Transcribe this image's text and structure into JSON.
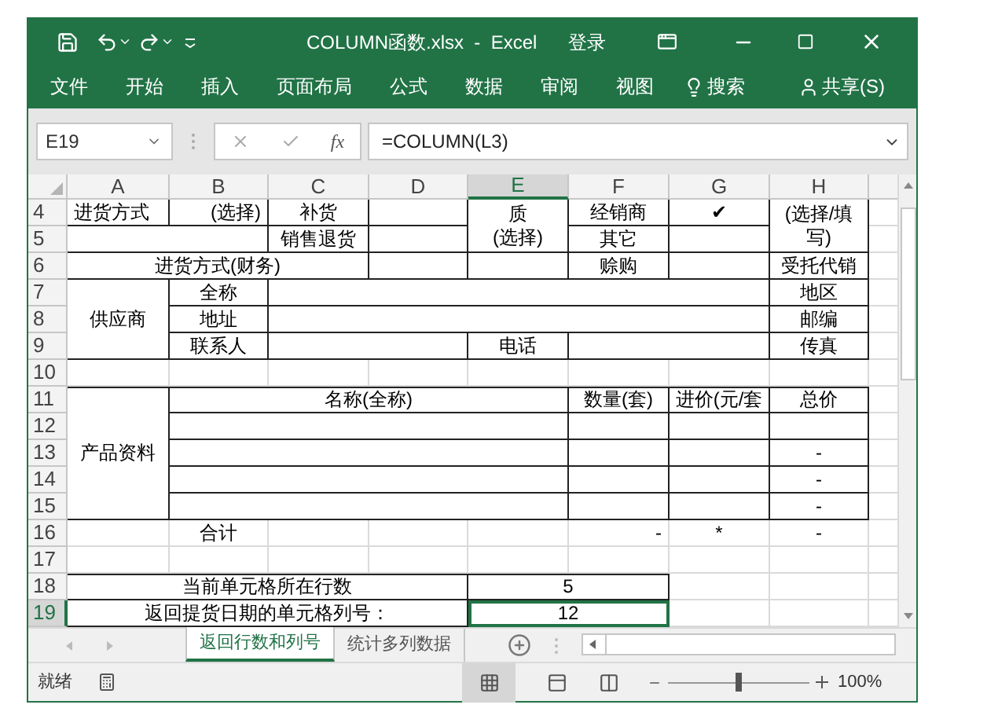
{
  "window": {
    "title": "COLUMN函数.xlsx  -  Excel",
    "sign_in": "登录"
  },
  "ribbon_tabs": [
    "文件",
    "开始",
    "插入",
    "页面布局",
    "公式",
    "数据",
    "审阅",
    "视图"
  ],
  "search": "搜索",
  "share": "共享(S)",
  "formula_bar": {
    "name_box": "E19",
    "fx": "fx",
    "formula": "=COLUMN(L3)"
  },
  "columns": [
    {
      "label": "A",
      "selected": false
    },
    {
      "label": "B",
      "selected": false
    },
    {
      "label": "C",
      "selected": false
    },
    {
      "label": "D",
      "selected": false
    },
    {
      "label": "E",
      "selected": true
    },
    {
      "label": "F",
      "selected": false
    },
    {
      "label": "G",
      "selected": false
    },
    {
      "label": "H",
      "selected": false
    }
  ],
  "rows": [
    {
      "number": "4",
      "selected": false,
      "cells": [
        "进货方式",
        "(选择)",
        "补货",
        "质\n(选择)",
        "经销商",
        "✔",
        "(选择/填写)"
      ]
    },
    {
      "number": "5",
      "selected": false,
      "cells": [
        "销售退货",
        "其它"
      ]
    },
    {
      "number": "6",
      "selected": false,
      "cells": [
        "进货方式(财务)",
        "赊购",
        "受托代销"
      ]
    },
    {
      "number": "7",
      "selected": false,
      "cells": [
        "供应商",
        "全称",
        "地区"
      ]
    },
    {
      "number": "8",
      "selected": false,
      "cells": [
        "地址",
        "邮编"
      ]
    },
    {
      "number": "9",
      "selected": false,
      "cells": [
        "联系人",
        "电话",
        "传真"
      ]
    },
    {
      "number": "10",
      "selected": false,
      "cells": []
    },
    {
      "number": "11",
      "selected": false,
      "cells": [
        "产品资料",
        "名称(全称)",
        "数量(套)",
        "进价(元/套",
        "总价"
      ]
    },
    {
      "number": "12",
      "selected": false,
      "cells": []
    },
    {
      "number": "13",
      "selected": false,
      "cells": [
        "-"
      ]
    },
    {
      "number": "14",
      "selected": false,
      "cells": [
        "-"
      ]
    },
    {
      "number": "15",
      "selected": false,
      "cells": [
        "-"
      ]
    },
    {
      "number": "16",
      "selected": false,
      "cells": [
        "合计",
        "-",
        "*",
        "-"
      ]
    },
    {
      "number": "17",
      "selected": false,
      "cells": []
    },
    {
      "number": "18",
      "selected": false,
      "cells": [
        "当前单元格所在行数",
        "5"
      ]
    },
    {
      "number": "19",
      "selected": true,
      "cells": [
        "返回提货日期的单元格列号：",
        "12"
      ]
    }
  ],
  "sheet_tabs": [
    {
      "label": "返回行数和列号",
      "selected": true
    },
    {
      "label": "统计多列数据",
      "selected": false
    }
  ],
  "status_bar": {
    "text": "就绪",
    "zoom": "100%",
    "zoom_slider": {
      "level": 0.5
    }
  }
}
